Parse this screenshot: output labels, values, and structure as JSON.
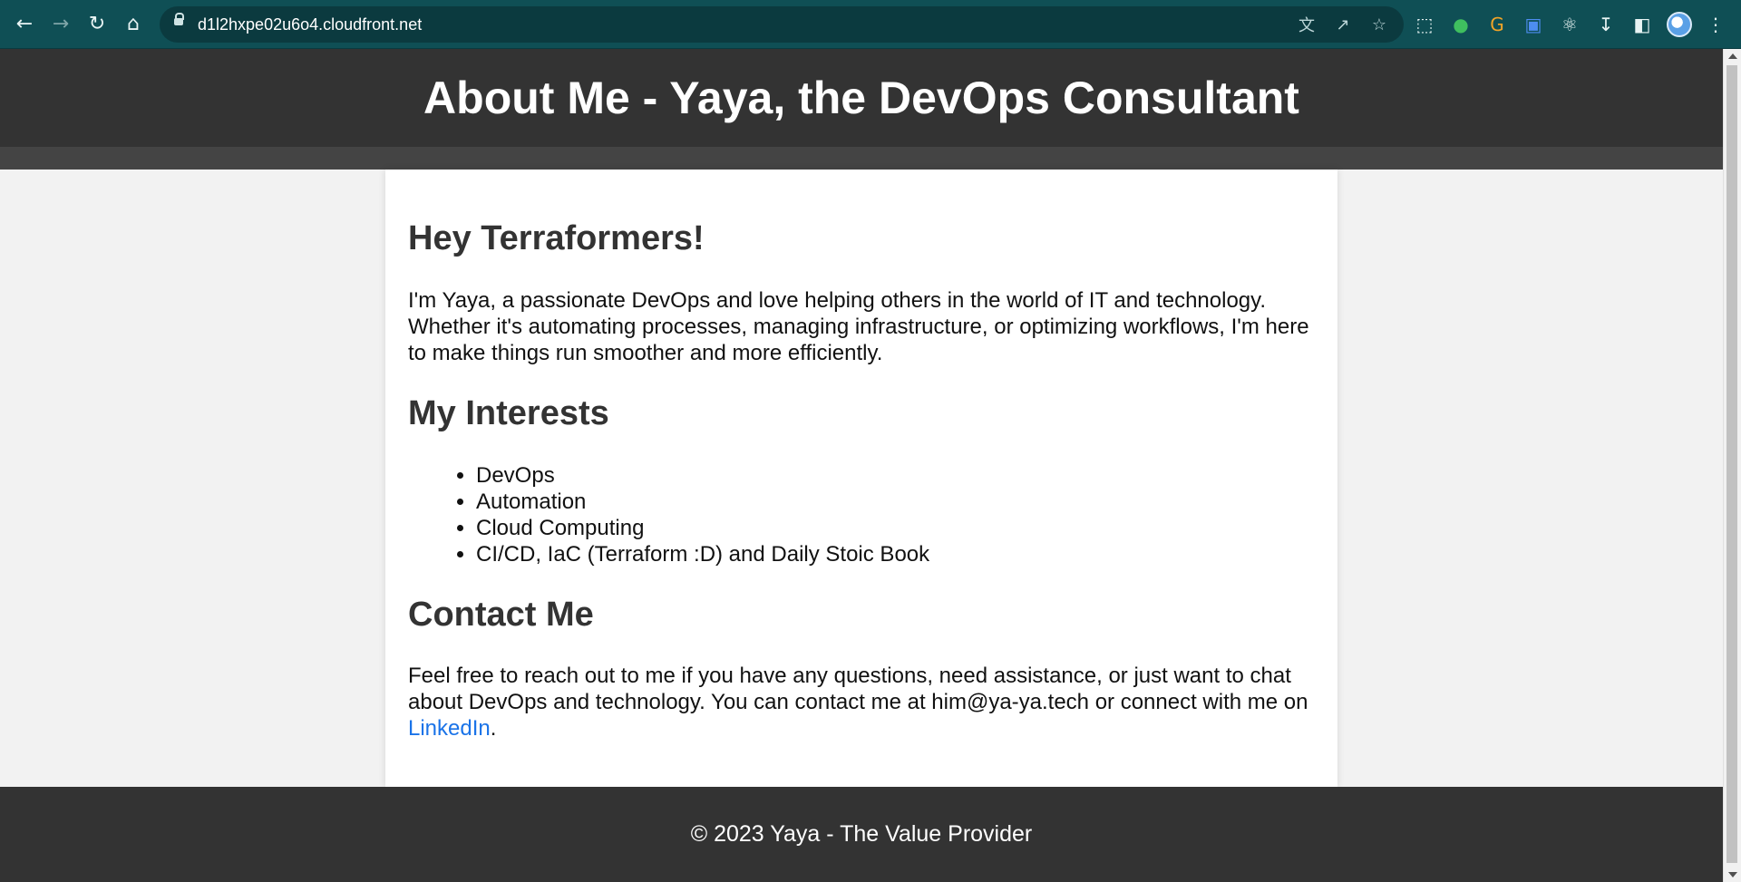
{
  "browser": {
    "url": "d1l2hxpe02u6o4.cloudfront.net",
    "icons": {
      "back": "back-arrow-icon",
      "forward": "forward-arrow-icon",
      "reload": "reload-icon",
      "home": "home-icon",
      "translate": "translate-icon",
      "share": "share-icon",
      "bookmark": "star-icon",
      "extensions": "puzzle-icon",
      "downloads": "download-icon",
      "side_panel": "side-panel-icon",
      "menu": "kebab-menu-icon"
    },
    "colors": {
      "toolbar": "#0f4f55",
      "omnibox": "#0b3a3f"
    }
  },
  "page": {
    "header_title": "About Me - Yaya, the DevOps Consultant",
    "greeting_heading": "Hey Terraformers!",
    "intro_paragraph": "I'm Yaya, a passionate DevOps and love helping others in the world of IT and technology. Whether it's automating processes, managing infrastructure, or optimizing workflows, I'm here to make things run smoother and more efficiently.",
    "interests_heading": "My Interests",
    "interests": [
      "DevOps",
      "Automation",
      "Cloud Computing",
      "CI/CD, IaC (Terraform :D) and Daily Stoic Book"
    ],
    "contact_heading": "Contact Me",
    "contact_text_before_link": "Feel free to reach out to me if you have any questions, need assistance, or just want to chat about DevOps and technology. You can contact me at him@ya-ya.tech or connect with me on ",
    "contact_link_label": "LinkedIn",
    "contact_text_after_link": ".",
    "footer_text": "© 2023 Yaya - The Value Provider",
    "colors": {
      "header_bg": "#333333",
      "link": "#1a73e8",
      "card_bg": "#ffffff",
      "page_bg": "#f2f2f2"
    }
  }
}
